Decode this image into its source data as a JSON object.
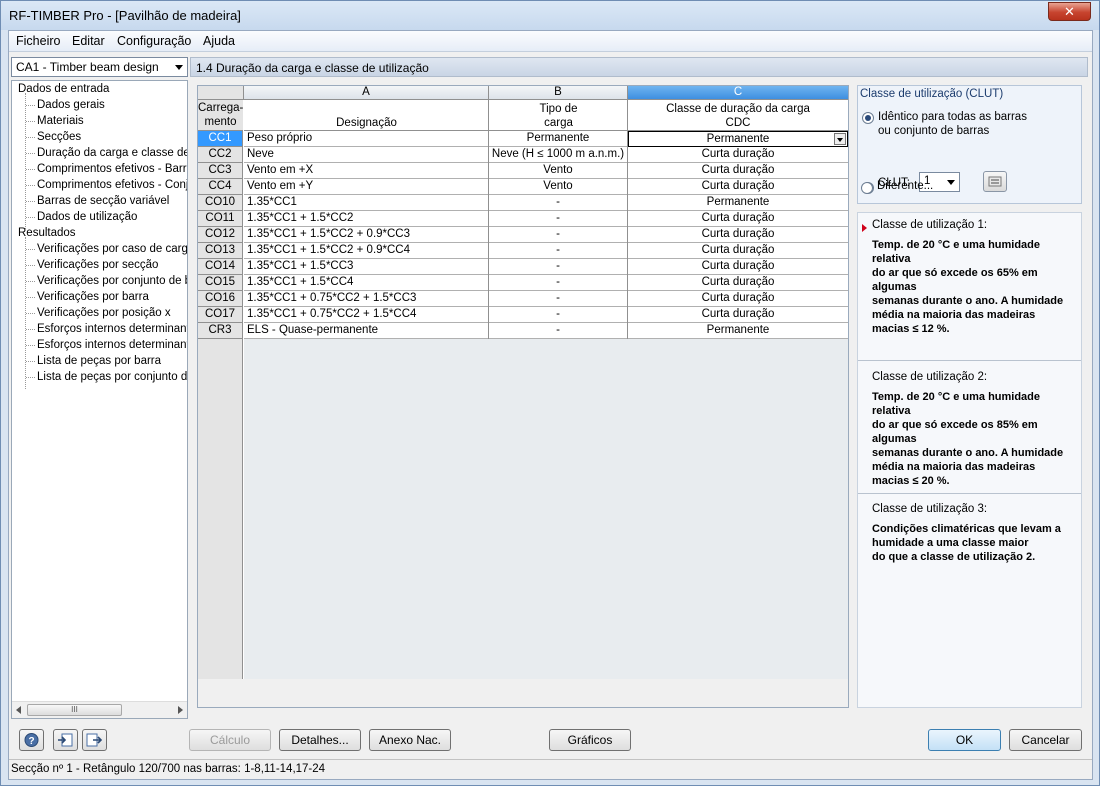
{
  "window": {
    "title": "RF-TIMBER Pro - [Pavilhão de madeira]",
    "close_glyph": "✕"
  },
  "menu": [
    "Ficheiro",
    "Editar",
    "Configuração",
    "Ajuda"
  ],
  "case_selector": {
    "value": "CA1 - Timber beam design"
  },
  "tree": {
    "input_root": "Dados de entrada",
    "input_items": [
      "Dados gerais",
      "Materiais",
      "Secções",
      "Duração da carga e classe de u",
      "Comprimentos efetivos - Barras",
      "Comprimentos efetivos - Conju",
      "Barras de secção variável",
      "Dados de utilização"
    ],
    "results_root": "Resultados",
    "results_items": [
      "Verificações por caso de carga",
      "Verificações por secção",
      "Verificações por conjunto de ba",
      "Verificações por barra",
      "Verificações por posição x",
      "Esforços internos determinante",
      "Esforços internos determinante",
      "Lista de peças por barra",
      "Lista de peças por conjunto de"
    ],
    "scroll_thumb_grip": "III"
  },
  "section_title": "1.4 Duração da carga e classe de utilização",
  "table": {
    "col_letters": [
      "A",
      "B",
      "C"
    ],
    "rowhdr_title": "Carrega-\nmento",
    "col_titles": [
      "Designação",
      "Tipo de\ncarga",
      "Classe de duração da carga\nCDC"
    ],
    "rows": [
      {
        "id": "CC1",
        "name": "Peso próprio",
        "type": "Permanente",
        "cdc": "Permanente"
      },
      {
        "id": "CC2",
        "name": "Neve",
        "type": "Neve (H ≤ 1000 m a.n.m.)",
        "cdc": "Curta duração"
      },
      {
        "id": "CC3",
        "name": "Vento em +X",
        "type": "Vento",
        "cdc": "Curta duração"
      },
      {
        "id": "CC4",
        "name": "Vento em +Y",
        "type": "Vento",
        "cdc": "Curta duração"
      },
      {
        "id": "CO10",
        "name": "1.35*CC1",
        "type": "-",
        "cdc": "Permanente"
      },
      {
        "id": "CO11",
        "name": "1.35*CC1 + 1.5*CC2",
        "type": "-",
        "cdc": "Curta duração"
      },
      {
        "id": "CO12",
        "name": "1.35*CC1 + 1.5*CC2 + 0.9*CC3",
        "type": "-",
        "cdc": "Curta duração"
      },
      {
        "id": "CO13",
        "name": "1.35*CC1 + 1.5*CC2 + 0.9*CC4",
        "type": "-",
        "cdc": "Curta duração"
      },
      {
        "id": "CO14",
        "name": "1.35*CC1 + 1.5*CC3",
        "type": "-",
        "cdc": "Curta duração"
      },
      {
        "id": "CO15",
        "name": "1.35*CC1 + 1.5*CC4",
        "type": "-",
        "cdc": "Curta duração"
      },
      {
        "id": "CO16",
        "name": "1.35*CC1 + 0.75*CC2 + 1.5*CC3",
        "type": "-",
        "cdc": "Curta duração"
      },
      {
        "id": "CO17",
        "name": "1.35*CC1 + 0.75*CC2 + 1.5*CC4",
        "type": "-",
        "cdc": "Curta duração"
      },
      {
        "id": "CR3",
        "name": "ELS - Quase-permanente",
        "type": "-",
        "cdc": "Permanente"
      }
    ]
  },
  "clut": {
    "legend": "Classe de utilização (CLUT)",
    "option_same": "Idêntico para todas as barras\nou conjunto de barras",
    "clut_label": "CLUT:",
    "clut_value": "1",
    "option_different": "Diferente..."
  },
  "info": [
    {
      "heading": "Classe de utilização 1:",
      "body": "Temp. de 20 °C e uma humidade relativa\ndo ar que só excede os 65% em algumas\nsemanas durante o ano. A humidade\nmédia na maioria das madeiras\nmacias ≤ 12 %."
    },
    {
      "heading": "Classe de utilização 2:",
      "body": "Temp. de 20 °C e uma humidade relativa\ndo ar que só excede os 85% em algumas\nsemanas durante o ano. A humidade\nmédia na maioria das madeiras\nmacias ≤ 20 %."
    },
    {
      "heading": "Classe de utilização 3:",
      "body": "Condições climatéricas que levam a\nhumidade a uma classe maior\ndo que a classe de utilização 2."
    }
  ],
  "buttons": {
    "calc": "Cálculo",
    "details": "Detalhes...",
    "annex": "Anexo Nac.",
    "graphics": "Gráficos",
    "ok": "OK",
    "cancel": "Cancelar"
  },
  "status": "Secção nº 1 - Retângulo 120/700 nas barras: 1-8,11-14,17-24"
}
